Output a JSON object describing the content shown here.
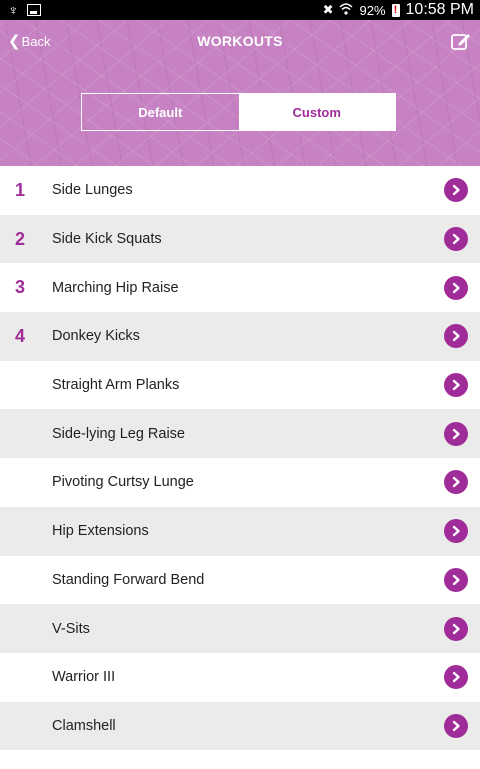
{
  "status_bar": {
    "usb_icon": "usb-icon",
    "gallery_icon": "gallery-icon",
    "mute_icon": "mute-icon",
    "wifi_icon": "wifi-icon",
    "battery_percent": "92%",
    "time": "10:58 PM"
  },
  "header": {
    "back_label": "Back",
    "title": "WORKOUTS",
    "edit_icon": "edit-icon",
    "background_color": "#c682c2"
  },
  "segments": {
    "default_label": "Default",
    "custom_label": "Custom",
    "selected": "Custom"
  },
  "accent_color": "#a02c9a",
  "workouts": [
    {
      "number": "1",
      "name": "Side Lunges"
    },
    {
      "number": "2",
      "name": "Side Kick Squats"
    },
    {
      "number": "3",
      "name": "Marching Hip Raise"
    },
    {
      "number": "4",
      "name": "Donkey Kicks"
    },
    {
      "number": "",
      "name": "Straight Arm Planks"
    },
    {
      "number": "",
      "name": "Side-lying Leg Raise"
    },
    {
      "number": "",
      "name": "Pivoting Curtsy Lunge"
    },
    {
      "number": "",
      "name": "Hip Extensions"
    },
    {
      "number": "",
      "name": "Standing Forward Bend"
    },
    {
      "number": "",
      "name": "V-Sits"
    },
    {
      "number": "",
      "name": "Warrior III"
    },
    {
      "number": "",
      "name": "Clamshell"
    }
  ]
}
